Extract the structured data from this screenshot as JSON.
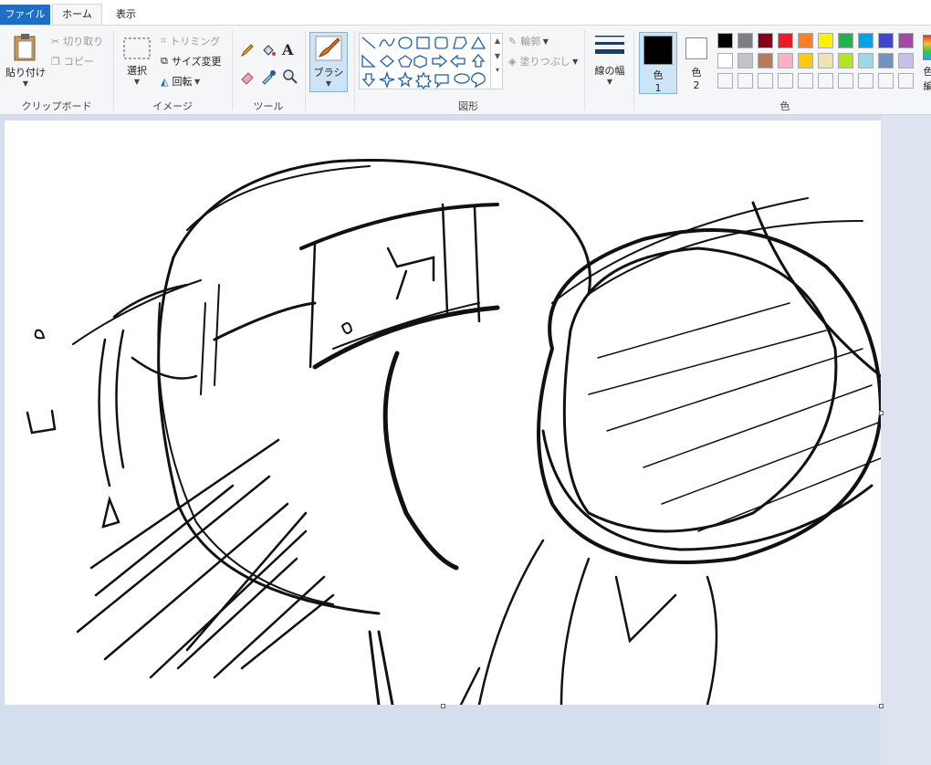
{
  "tabs": {
    "file": "ファイル",
    "home": "ホーム",
    "view": "表示"
  },
  "clipboard": {
    "paste": "貼り付け",
    "cut": "切り取り",
    "copy": "コピー",
    "label": "クリップボード"
  },
  "image": {
    "select": "選択",
    "crop": "トリミング",
    "resize": "サイズ変更",
    "rotate": "回転",
    "label": "イメージ"
  },
  "tools": {
    "label": "ツール"
  },
  "brush": {
    "label": "ブラシ"
  },
  "shapes": {
    "outline": "輪郭",
    "fill": "塗りつぶし",
    "label": "図形"
  },
  "line_width": {
    "label": "線の幅"
  },
  "colors": {
    "color1_label": "色",
    "color1_num": "1",
    "color2_label": "色",
    "color2_num": "2",
    "edit_label": "色",
    "edit_label2": "編",
    "label": "色",
    "row1": [
      "#000000",
      "#7f7f7f",
      "#880015",
      "#ed1c24",
      "#ff7f27",
      "#fff200",
      "#22b14c",
      "#00a2e8",
      "#3f48cc",
      "#a349a4"
    ],
    "row2": [
      "#ffffff",
      "#c3c3c3",
      "#b97a57",
      "#ffaec9",
      "#ffc90e",
      "#efe4b0",
      "#b5e61d",
      "#99d9ea",
      "#7092be",
      "#c8bfe7"
    ],
    "accent": "#1e6ec8"
  }
}
